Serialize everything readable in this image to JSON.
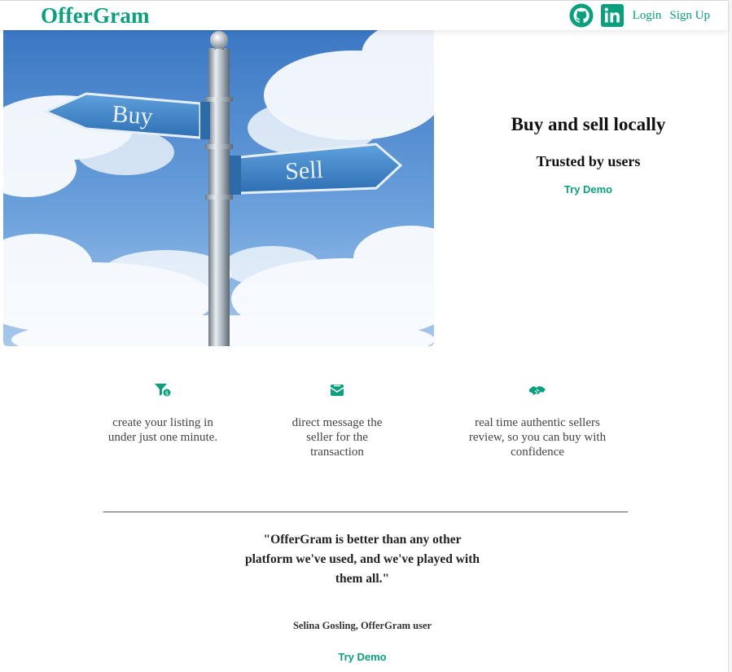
{
  "brand": {
    "name": "OfferGram",
    "color": "#0aa07e"
  },
  "nav": {
    "icons": [
      "github-icon",
      "linkedin-icon"
    ],
    "login": "Login",
    "signup": "Sign Up"
  },
  "hero": {
    "image_signs": {
      "left": "Buy",
      "right": "Sell"
    },
    "title": "Buy and sell locally",
    "subtitle": "Trusted by users",
    "cta": "Try Demo"
  },
  "features": [
    {
      "icon": "filter-dollar-icon",
      "text": "create your listing in under just one minute."
    },
    {
      "icon": "mail-bulk-icon",
      "text": "direct message the seller for the transaction"
    },
    {
      "icon": "handshake-icon",
      "text": "real time authentic sellers review, so you can buy with confidence"
    }
  ],
  "testimonial": {
    "quote": "\"OfferGram is better than any other platform we've used, and we've played with them all.\"",
    "author": "Selina Gosling, OfferGram user",
    "cta": "Try Demo"
  }
}
